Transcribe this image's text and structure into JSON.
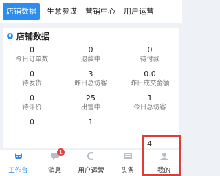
{
  "tabs": [
    {
      "label": "店铺数据"
    },
    {
      "label": "生意参谋"
    },
    {
      "label": "营销中心"
    },
    {
      "label": "用户运营"
    }
  ],
  "card": {
    "title": "店铺数据",
    "metrics": [
      {
        "value": "0",
        "label": "今日订单数"
      },
      {
        "value": "0",
        "label": "退款中"
      },
      {
        "value": "0",
        "label": "待付款"
      },
      {
        "value": "0",
        "label": "待发货"
      },
      {
        "value": "3",
        "label": "昨日总访客"
      },
      {
        "value": "0.0",
        "label": "昨日成交金额"
      },
      {
        "value": "0",
        "label": "待评价"
      },
      {
        "value": "25",
        "label": "出售中"
      },
      {
        "value": "1",
        "label": "今日总访客"
      },
      {
        "value": "0",
        "label": ""
      },
      {
        "value": "1",
        "label": ""
      },
      {
        "value": "4",
        "label": ""
      }
    ]
  },
  "bottom_nav": {
    "items": [
      {
        "label": "工作台",
        "icon": "cow-icon"
      },
      {
        "label": "消息",
        "icon": "chat-icon",
        "badge": "1"
      },
      {
        "label": "用户运营",
        "icon": "user-ops-icon"
      },
      {
        "label": "头条",
        "icon": "news-icon"
      },
      {
        "label": "我的",
        "icon": "profile-icon"
      }
    ]
  },
  "colors": {
    "accent": "#2d8cf0",
    "badge": "#e54040",
    "highlight": "#e03b3b"
  }
}
